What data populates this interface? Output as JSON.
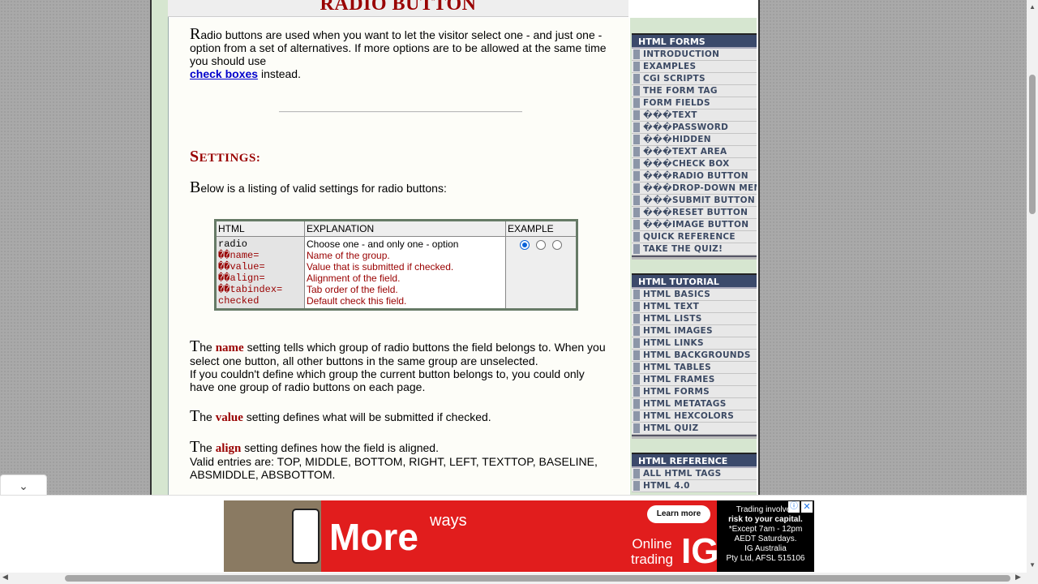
{
  "title": "RADIO BUTTON",
  "intro": {
    "dropcap": "R",
    "text": "adio buttons are used when you want to let the visitor select one - and just one - option from a set of alternatives. If more options are to be allowed at the same time you should use",
    "link": "check boxes",
    "after_link": " instead."
  },
  "settings_heading": {
    "cap": "S",
    "rest": "ETTINGS:"
  },
  "below": {
    "dropcap": "B",
    "text": "elow is a listing of valid settings for radio buttons:"
  },
  "table": {
    "headers": [
      "HTML",
      "EXPLANATION",
      "EXAMPLE"
    ],
    "code_first": "radio",
    "code_lines": [
      "��name=",
      "��value=",
      "��align=",
      "��tabindex=",
      "checked"
    ],
    "expl_first": "Choose one - and only one - option",
    "expl_lines": [
      "Name of the group.",
      "Value that is submitted if checked.",
      "Alignment of the field.",
      "Tab order of the field.",
      "Default check this field."
    ]
  },
  "name_para": {
    "dropcap": "T",
    "pre": "he ",
    "kw": "name",
    "text": " setting tells which group of radio buttons the field belongs to. When you select one button, all other buttons in the same group are unselected.",
    "text2": "If you couldn't define which group the current button belongs to, you could only have one group of radio buttons on each page."
  },
  "value_para": {
    "dropcap": "T",
    "pre": "he ",
    "kw": "value",
    "text": " setting defines what will be submitted if checked."
  },
  "align_para": {
    "dropcap": "T",
    "pre": "he ",
    "kw": "align",
    "text": " setting defines how the field is aligned.",
    "text2": "Valid entries are: TOP, MIDDLE, BOTTOM, RIGHT, LEFT, TEXTTOP, BASELINE, ABSMIDDLE, ABSBOTTOM."
  },
  "sidebar": {
    "forms": {
      "heading": "HTML FORMS",
      "items": [
        "INTRODUCTION",
        "EXAMPLES",
        "CGI SCRIPTS",
        "THE FORM TAG",
        "FORM FIELDS",
        "���TEXT",
        "���PASSWORD",
        "���HIDDEN",
        "���TEXT AREA",
        "���CHECK BOX",
        "���RADIO BUTTON",
        "���DROP-DOWN MENU",
        "���SUBMIT BUTTON",
        "���RESET BUTTON",
        "���IMAGE BUTTON",
        "QUICK REFERENCE",
        "TAKE THE QUIZ!"
      ]
    },
    "tutorial": {
      "heading": "HTML TUTORIAL",
      "items": [
        "HTML BASICS",
        "HTML TEXT",
        "HTML LISTS",
        "HTML IMAGES",
        "HTML LINKS",
        "HTML BACKGROUNDS",
        "HTML TABLES",
        "HTML FRAMES",
        "HTML FORMS",
        "HTML METATAGS",
        "HTML HEXCOLORS",
        "HTML QUIZ"
      ]
    },
    "reference": {
      "heading": "HTML REFERENCE",
      "items": [
        "ALL HTML TAGS",
        "HTML 4.0"
      ]
    }
  },
  "ad": {
    "more": "More",
    "ways": "ways",
    "learn_more": "Learn more",
    "online": "Online trading",
    "brand": "IG",
    "risk_1": "Trading involves",
    "risk_2": "risk to your capital.",
    "risk_3": "*Except 7am - 12pm",
    "risk_4": "AEDT Saturdays.",
    "risk_5": "IG Australia",
    "risk_6": "Pty Ltd, AFSL 515106",
    "close": "✕",
    "info": "ⓘ"
  },
  "collapse_icon": "chevron-down-icon"
}
